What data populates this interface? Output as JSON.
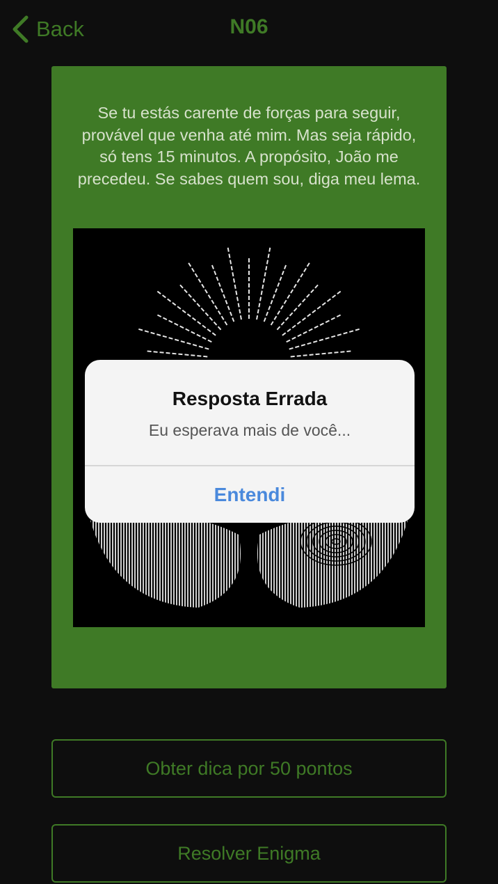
{
  "nav": {
    "back_label": "Back",
    "title": "N06"
  },
  "riddle": {
    "text": "Se tu estás carente de forças para seguir, provável que venha até mim. Mas seja rápido, só tens 15 minutos. A propósito, João me precedeu. Se sabes quem sou, diga meu lema."
  },
  "actions": {
    "hint_label": "Obter dica por 50 pontos",
    "solve_label": "Resolver Enigma"
  },
  "alert": {
    "title": "Resposta Errada",
    "message": "Eu esperava mais de você...",
    "button_label": "Entendi"
  },
  "colors": {
    "background": "#0e0e0e",
    "accent_green": "#3f7a26",
    "card_text": "#d7e2cc",
    "alert_button": "#4a89dc"
  },
  "icons": {
    "back": "chevron-left-icon"
  }
}
